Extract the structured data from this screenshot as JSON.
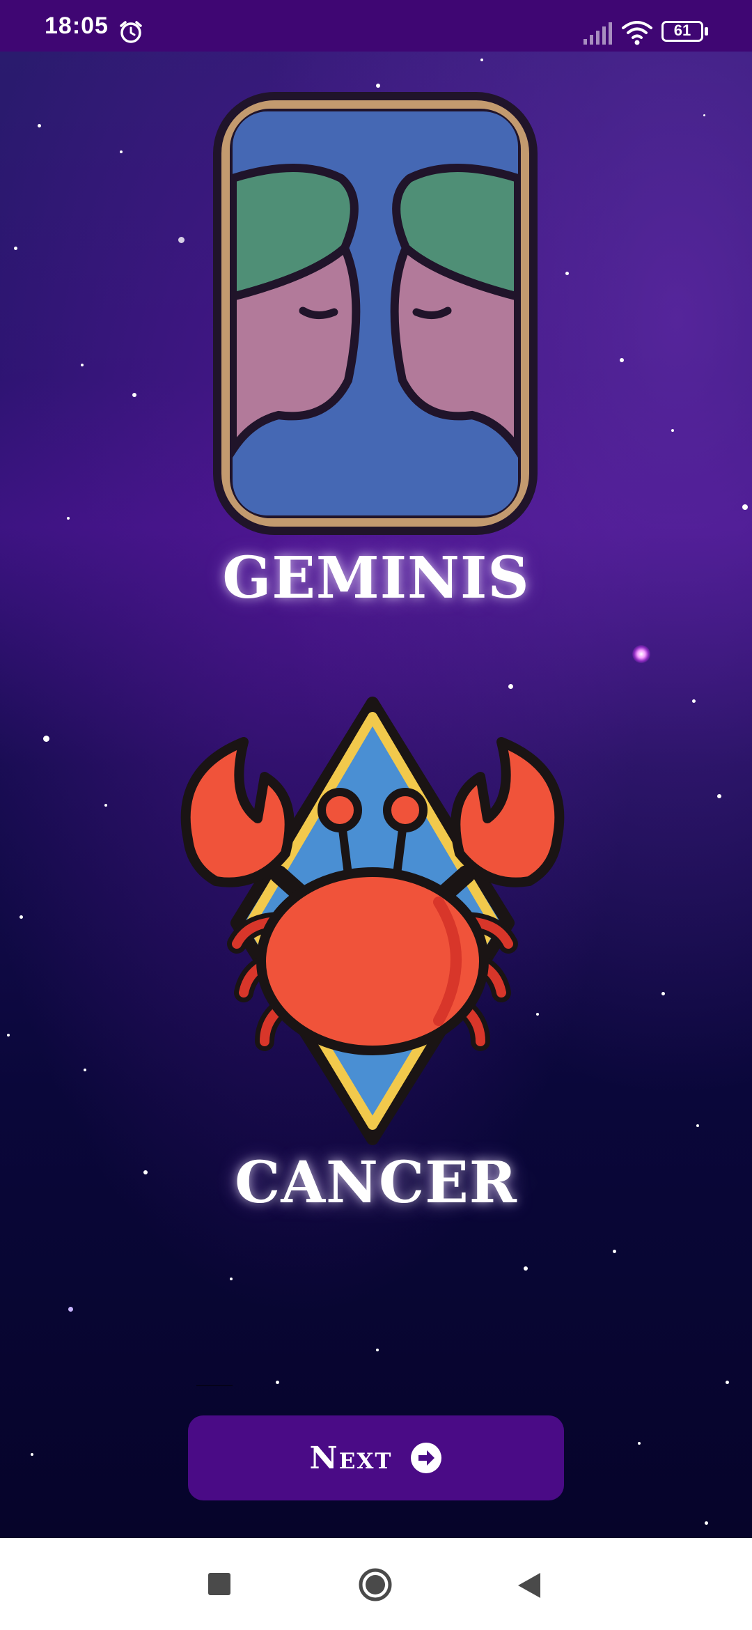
{
  "status_bar": {
    "time": "18:05",
    "battery": "61"
  },
  "signs": [
    {
      "name": "GEMINIS",
      "icon": "gemini-icon"
    },
    {
      "name": "CANCER",
      "icon": "cancer-crab-icon"
    }
  ],
  "next_button": {
    "label": "Next",
    "icon": "arrow-right-circle-icon"
  },
  "navigation_bar": {
    "recents": "square-icon",
    "home": "circle-icon",
    "back": "triangle-back-icon"
  },
  "colors": {
    "status_bar": "#3f0673",
    "button": "#4a0b86",
    "background": "#06042a"
  }
}
